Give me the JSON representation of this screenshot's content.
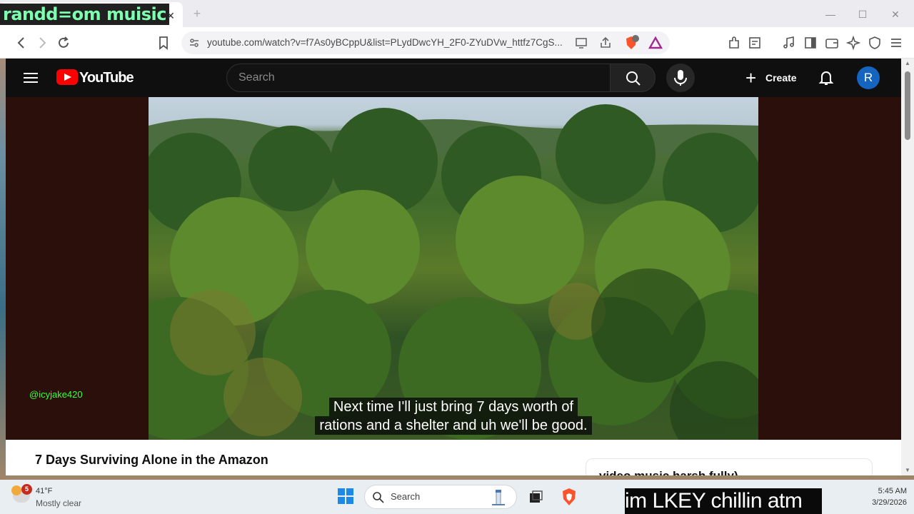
{
  "browser": {
    "tab_title": "randd=om muisic",
    "tab_close": "✕",
    "new_tab": "+",
    "url": "youtube.com/watch?v=f7As0yBCppU&list=PLydDwcYH_2F0-ZYuDVw_httfz7CgS...",
    "shield_count": "34",
    "window": {
      "minimize": "—",
      "maximize": "☐",
      "close": "✕"
    }
  },
  "youtube": {
    "logo_text": "YouTube",
    "search_placeholder": "Search",
    "create_label": "Create",
    "avatar_initial": "R"
  },
  "video": {
    "caption_line1": "Next time I'll just bring 7 days worth of",
    "caption_line2": "rations and a shelter and uh we'll be good.",
    "watermark": "@icyjake420",
    "title": "7 Days Surviving Alone in the Amazon"
  },
  "side_card": {
    "partial_text": "video music harsh fully)"
  },
  "taskbar": {
    "weather_badge": "5",
    "weather_temp": "41°F",
    "weather_desc": "Mostly clear",
    "search_label": "Search",
    "time": "5:45 AM",
    "date": "3/29/2026"
  },
  "stream_overlay": {
    "text": "im LKEY chillin atm"
  },
  "colors": {
    "youtube_red": "#ff0000",
    "tab_overlay_text": "#7dffb0",
    "watermark_green": "#3cff3c",
    "avatar_blue": "#1565c0"
  }
}
